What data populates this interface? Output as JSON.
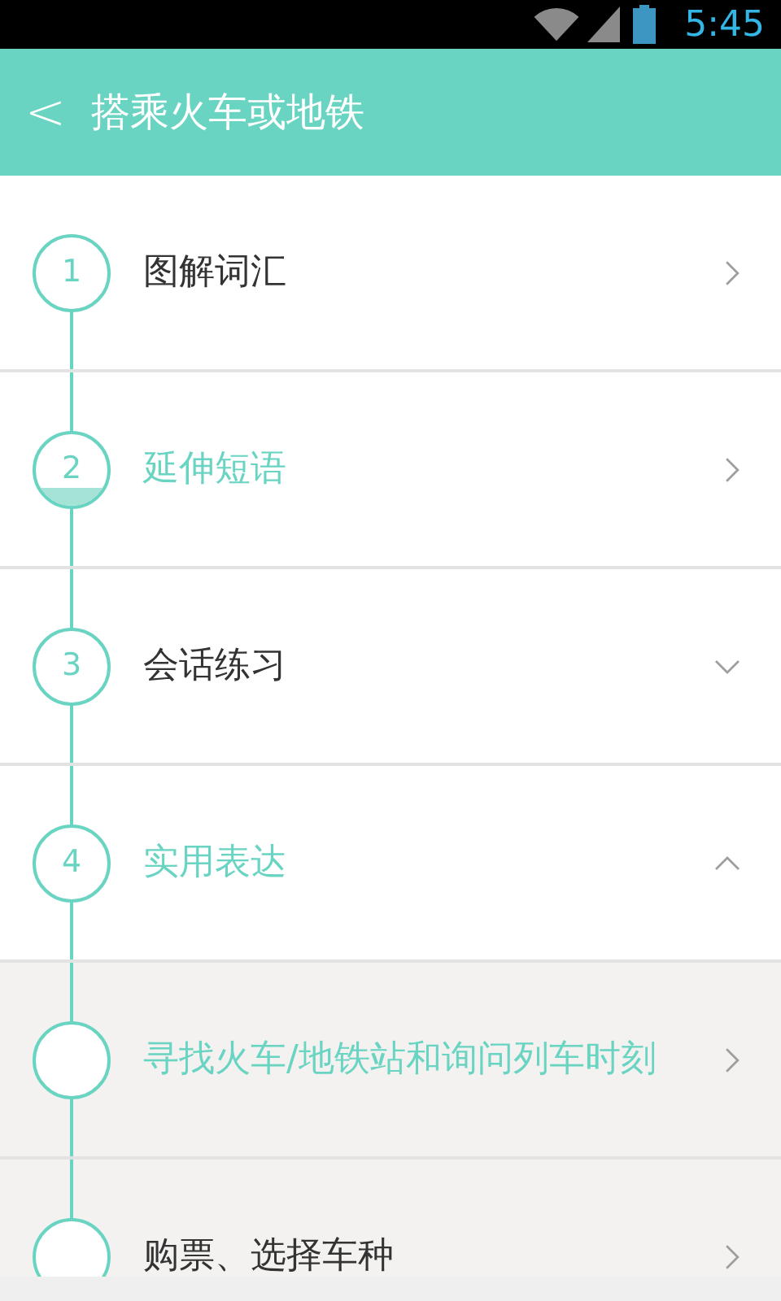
{
  "status_bar": {
    "time": "5:45"
  },
  "header": {
    "back": "<",
    "title": "搭乘火车或地铁"
  },
  "steps": [
    {
      "number": "1",
      "label": "图解词汇",
      "kind": "link",
      "selected": false,
      "started": false
    },
    {
      "number": "2",
      "label": "延伸短语",
      "kind": "link",
      "selected": true,
      "started": true
    },
    {
      "number": "3",
      "label": "会话练习",
      "kind": "section",
      "selected": false,
      "started": false,
      "expanded": false
    },
    {
      "number": "4",
      "label": "实用表达",
      "kind": "section",
      "selected": true,
      "started": false,
      "expanded": true,
      "children": [
        {
          "label": "寻找火车/地铁站和询问列车时刻",
          "selected": true
        },
        {
          "label": "购票、选择车种",
          "selected": false
        }
      ]
    }
  ]
}
